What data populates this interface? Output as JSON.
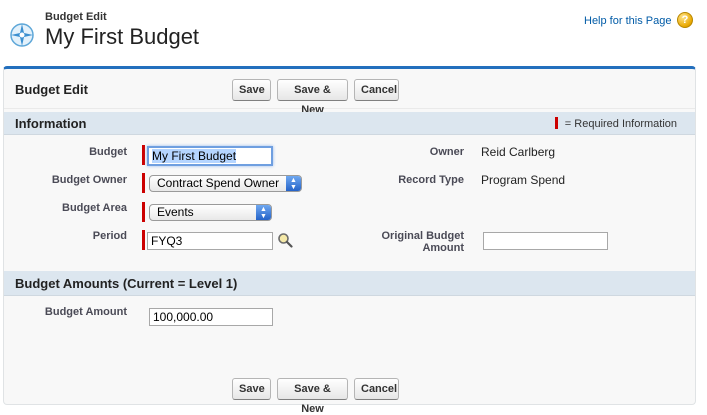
{
  "header": {
    "breadcrumb": "Budget Edit",
    "title": "My First Budget",
    "help_link": "Help for this Page",
    "help_icon": "help-icon"
  },
  "panel": {
    "title": "Budget Edit",
    "buttons": {
      "save": "Save",
      "save_new": "Save & New",
      "cancel": "Cancel"
    }
  },
  "information": {
    "section_title": "Information",
    "required_legend": "= Required Information",
    "fields": {
      "budget": {
        "label": "Budget",
        "value": "My First Budget"
      },
      "budget_owner": {
        "label": "Budget Owner",
        "value": "Contract Spend Owner"
      },
      "budget_area": {
        "label": "Budget Area",
        "value": "Events"
      },
      "period": {
        "label": "Period",
        "value": "FYQ3"
      },
      "owner": {
        "label": "Owner",
        "value": "Reid Carlberg"
      },
      "record_type": {
        "label": "Record Type",
        "value": "Program Spend"
      },
      "original_budget_amount": {
        "label_line1": "Original Budget",
        "label_line2": "Amount",
        "value": ""
      }
    }
  },
  "amounts": {
    "section_title": "Budget Amounts (Current = Level 1)",
    "budget_amount": {
      "label": "Budget Amount",
      "value": "100,000.00"
    }
  },
  "colors": {
    "accent": "#236fbd",
    "required": "#cc0000",
    "section_bg": "#dce6ef",
    "link": "#015ba7"
  }
}
